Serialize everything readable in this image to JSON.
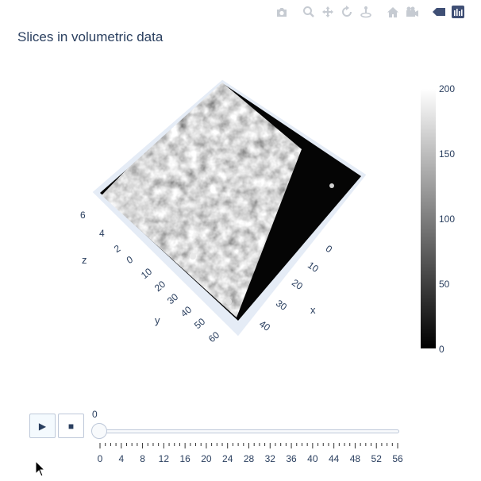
{
  "modebar": {
    "icons": [
      "camera-icon",
      "zoom-icon",
      "pan-icon",
      "orbit-rotation-icon",
      "turntable-rotation-icon",
      "reset-camera-home-icon",
      "reset-camera-last-save-icon",
      "toggle-spike-lines-icon",
      "plotly-logo-icon"
    ]
  },
  "title": "Slices in volumetric data",
  "scene": {
    "x_axis": {
      "title": "x",
      "tick_labels": [
        "0",
        "10",
        "20",
        "30",
        "40"
      ]
    },
    "y_axis": {
      "title": "y",
      "tick_labels": [
        "0",
        "10",
        "20",
        "30",
        "40",
        "50",
        "60"
      ]
    },
    "z_axis": {
      "title": "z",
      "tick_labels": [
        "0",
        "2",
        "4",
        "6"
      ]
    },
    "colorscale": "gray"
  },
  "colorbar": {
    "tick_labels": [
      "200",
      "150",
      "100",
      "50",
      "0"
    ]
  },
  "controls": {
    "play_icon": "▶",
    "stop_icon": "■"
  },
  "slider": {
    "current_value": "0",
    "tick_labels": [
      "0",
      "4",
      "8",
      "12",
      "16",
      "20",
      "24",
      "28",
      "32",
      "36",
      "40",
      "44",
      "48",
      "52",
      "56"
    ]
  },
  "chart_data": {
    "type": "heatmap",
    "title": "Slices in volumetric data",
    "colorscale": "gray",
    "color_range": [
      0,
      200
    ],
    "colorbar_ticks": [
      0,
      50,
      100,
      150,
      200
    ],
    "x_ticks": [
      0,
      10,
      20,
      30,
      40
    ],
    "y_ticks": [
      0,
      10,
      20,
      30,
      40,
      50,
      60
    ],
    "z_ticks": [
      0,
      2,
      4,
      6
    ],
    "xlabel": "x",
    "ylabel": "y",
    "zlabel": "z",
    "slider_frames": [
      0,
      4,
      8,
      12,
      16,
      20,
      24,
      28,
      32,
      36,
      40,
      44,
      48,
      52,
      56
    ],
    "slider_value": 0
  }
}
